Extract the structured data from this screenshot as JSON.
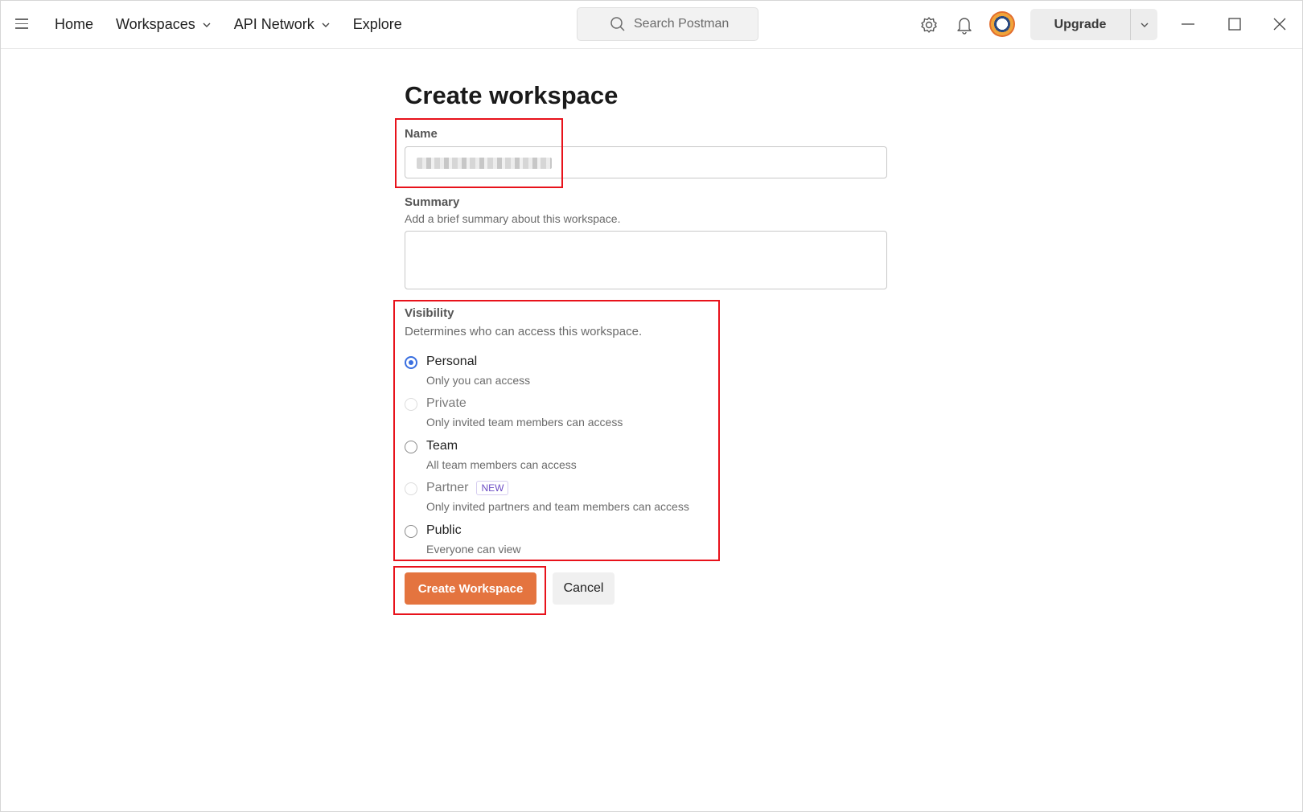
{
  "nav": {
    "home": "Home",
    "workspaces": "Workspaces",
    "api_network": "API Network",
    "explore": "Explore"
  },
  "search": {
    "placeholder": "Search Postman"
  },
  "header": {
    "upgrade_label": "Upgrade"
  },
  "form": {
    "title": "Create workspace",
    "name_label": "Name",
    "summary_label": "Summary",
    "summary_help": "Add a brief summary about this workspace.",
    "visibility_label": "Visibility",
    "visibility_help": "Determines who can access this workspace.",
    "options": [
      {
        "label": "Personal",
        "desc": "Only you can access",
        "state": "checked"
      },
      {
        "label": "Private",
        "desc": "Only invited team members can access",
        "state": "disabled"
      },
      {
        "label": "Team",
        "desc": "All team members can access",
        "state": "enabled"
      },
      {
        "label": "Partner",
        "desc": "Only invited partners and team members can access",
        "state": "disabled",
        "badge": "NEW"
      },
      {
        "label": "Public",
        "desc": "Everyone can view",
        "state": "enabled"
      }
    ],
    "create_label": "Create Workspace",
    "cancel_label": "Cancel"
  },
  "colors": {
    "accent": "#e4743f",
    "radio_selected": "#3a6fe0",
    "annotation": "#e8121b"
  },
  "icons": {
    "menu": "hamburger-menu-icon",
    "search": "search-icon",
    "settings": "gear-icon",
    "notifications": "bell-icon",
    "minimize": "minimize-icon",
    "maximize": "maximize-icon",
    "close": "close-icon"
  }
}
